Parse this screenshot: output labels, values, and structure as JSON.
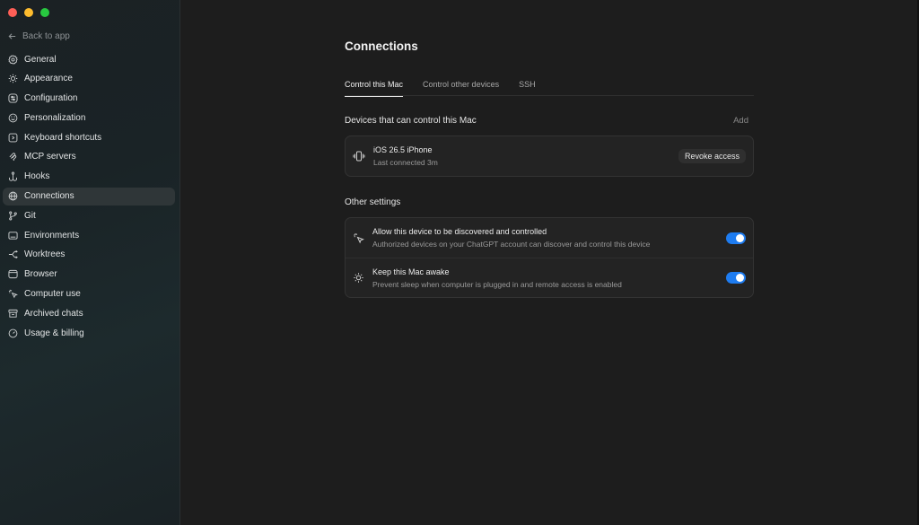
{
  "sidebar": {
    "back_label": "Back to app",
    "items": [
      {
        "label": "General",
        "icon": "gear-icon"
      },
      {
        "label": "Appearance",
        "icon": "sun-icon"
      },
      {
        "label": "Configuration",
        "icon": "sliders-icon"
      },
      {
        "label": "Personalization",
        "icon": "smile-icon"
      },
      {
        "label": "Keyboard shortcuts",
        "icon": "keyboard-icon"
      },
      {
        "label": "MCP servers",
        "icon": "mcp-icon"
      },
      {
        "label": "Hooks",
        "icon": "hook-icon"
      },
      {
        "label": "Connections",
        "icon": "globe-icon",
        "active": true
      },
      {
        "label": "Git",
        "icon": "git-branch-icon"
      },
      {
        "label": "Environments",
        "icon": "terminal-icon"
      },
      {
        "label": "Worktrees",
        "icon": "worktree-icon"
      },
      {
        "label": "Browser",
        "icon": "browser-icon"
      },
      {
        "label": "Computer use",
        "icon": "pointer-icon"
      },
      {
        "label": "Archived chats",
        "icon": "archive-icon"
      },
      {
        "label": "Usage & billing",
        "icon": "gauge-icon"
      }
    ]
  },
  "main": {
    "title": "Connections",
    "tabs": [
      {
        "label": "Control this Mac",
        "active": true
      },
      {
        "label": "Control other devices"
      },
      {
        "label": "SSH"
      }
    ],
    "devices_section": {
      "heading": "Devices that can control this Mac",
      "add_label": "Add",
      "device": {
        "name": "iOS 26.5 iPhone",
        "last_connected": "Last connected 3m",
        "revoke_label": "Revoke access"
      }
    },
    "other_settings": {
      "heading": "Other settings",
      "items": [
        {
          "title": "Allow this device to be discovered and controlled",
          "description": "Authorized devices on your ChatGPT account can discover and control this device",
          "enabled": true,
          "icon": "cursor-sparkle-icon"
        },
        {
          "title": "Keep this Mac awake",
          "description": "Prevent sleep when computer is plugged in and remote access is enabled",
          "enabled": true,
          "icon": "sun-icon"
        }
      ]
    }
  },
  "colors": {
    "accent": "#1e7cf0",
    "sidebar_active": "#2f3638",
    "main_bg": "#1d1d1d"
  }
}
